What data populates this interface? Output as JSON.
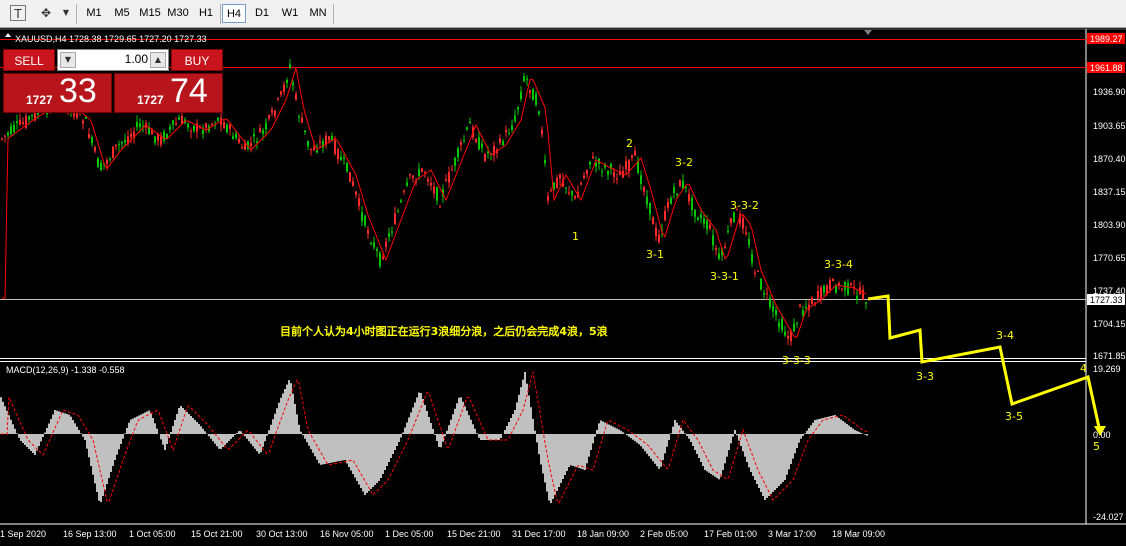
{
  "toolbar": {
    "timeframes": [
      "M1",
      "M5",
      "M15",
      "M30",
      "H1",
      "H4",
      "D1",
      "W1",
      "MN"
    ],
    "active_timeframe": "H4",
    "icons": [
      "text-tool-icon",
      "objects-tool-icon"
    ]
  },
  "chart_header": {
    "symbol_line": "XAUUSD,H4  1728.38 1729.65 1727.20 1727.33"
  },
  "trade_panel": {
    "sell_label": "SELL",
    "buy_label": "BUY",
    "lot_value": "1.00",
    "sell_price_small": "1727",
    "sell_price_big": "33",
    "buy_price_small": "1727",
    "buy_price_big": "74"
  },
  "price_axis": {
    "labels": [
      "1936.90",
      "1903.65",
      "1870.40",
      "1837.15",
      "1803.90",
      "1770.65",
      "1737.40",
      "1704.15",
      "1671.85"
    ],
    "tag_top": "1989.27",
    "tag_red": "1961.88",
    "tag_current": "1727.33"
  },
  "macd": {
    "header": "MACD(12,26,9) -1.338 -0.558",
    "axis_labels": [
      "19.269",
      "0.00",
      "-24.027"
    ]
  },
  "time_axis": {
    "labels": [
      "1 Sep 2020",
      "16 Sep 13:00",
      "1 Oct 05:00",
      "15 Oct 21:00",
      "30 Oct 13:00",
      "16 Nov 05:00",
      "1 Dec 05:00",
      "15 Dec 21:00",
      "31 Dec 17:00",
      "18 Jan 09:00",
      "2 Feb 05:00",
      "17 Feb 01:00",
      "3 Mar 17:00",
      "18 Mar 09:00"
    ]
  },
  "annotations": {
    "wave_labels": [
      "1",
      "2",
      "3-1",
      "3-2",
      "3-3-1",
      "3-3-2",
      "3-3-3",
      "3-3-4"
    ],
    "projection_labels": [
      "3-3",
      "3-4",
      "3-5",
      "4",
      "5"
    ],
    "note": "目前个人认为4小时图正在运行3浪细分浪，之后仍会完成4浪，5浪"
  },
  "colors": {
    "bull": "#00c800",
    "bear": "#ff2a2a",
    "ma": "#ff0000",
    "annotation": "#ffff00",
    "macd_hist": "#c0c0c0",
    "macd_signal": "#ff0000",
    "grid_line": "#ffffff"
  }
}
